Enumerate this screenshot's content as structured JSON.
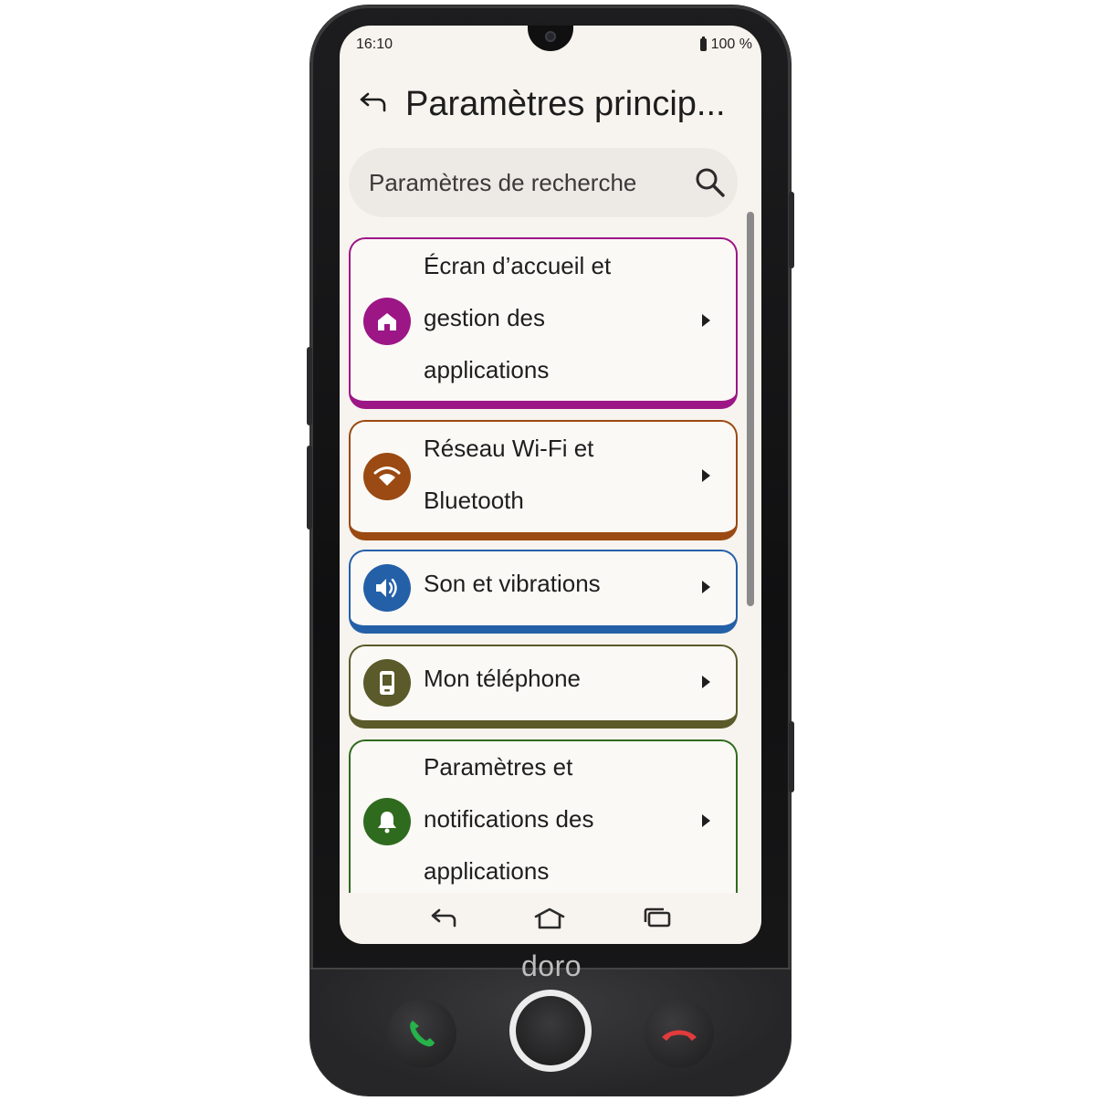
{
  "status_bar": {
    "time": "16:10",
    "battery": "100 %"
  },
  "header": {
    "title": "Paramètres princip..."
  },
  "search": {
    "placeholder": "Paramètres de recherche"
  },
  "settings": [
    {
      "label_lines": [
        "Écran d’accueil et",
        "gestion des",
        "applications"
      ],
      "icon": "home-icon",
      "color": "#9c1686"
    },
    {
      "label_lines": [
        "Réseau Wi-Fi et",
        "Bluetooth"
      ],
      "icon": "wifi-icon",
      "color": "#9a4a12"
    },
    {
      "label_lines": [
        "Son et vibrations"
      ],
      "icon": "volume-icon",
      "color": "#2460a8"
    },
    {
      "label_lines": [
        "Mon téléphone"
      ],
      "icon": "phone-device-icon",
      "color": "#5a5a2a"
    },
    {
      "label_lines": [
        "Paramètres et",
        "notifications des",
        "applications"
      ],
      "icon": "bell-icon",
      "color": "#2f6b1e"
    }
  ],
  "device": {
    "brand": "doro"
  }
}
